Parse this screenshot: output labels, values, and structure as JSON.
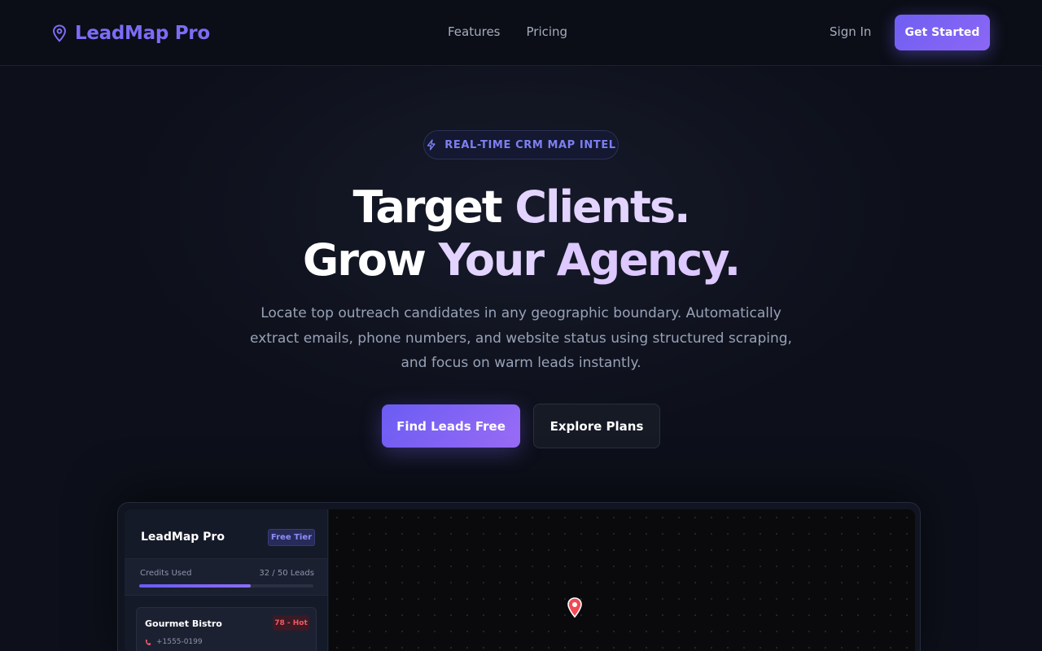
{
  "nav": {
    "brand": "LeadMap Pro",
    "links": [
      {
        "label": "Features"
      },
      {
        "label": "Pricing"
      }
    ],
    "signin": "Sign In",
    "cta": "Get Started"
  },
  "hero": {
    "badge": "REAL-TIME CRM MAP INTEL",
    "headline_line1_a": "Target ",
    "headline_line1_b": "Clients.",
    "headline_line2_a": "Grow ",
    "headline_line2_b": "Your ",
    "headline_line2_c": "Agency.",
    "subtext": "Locate top outreach candidates in any geographic boundary. Automatically extract emails, phone numbers, and website status using structured scraping, and focus on warm leads instantly.",
    "primary_button": "Find Leads Free",
    "secondary_button": "Explore Plans"
  },
  "preview": {
    "title": "LeadMap Pro",
    "tier": "Free Tier",
    "credits_label": "Credits Used",
    "credits_value": "32 / 50 Leads",
    "credits_used": 32,
    "credits_total": 50,
    "leads": [
      {
        "name": "Gourmet Bistro",
        "score": "78 - Hot",
        "phone": "+1555-0199"
      }
    ]
  },
  "colors": {
    "accent": "#7c6cf5",
    "hot": "#ef5a66",
    "background": "#0d101a"
  },
  "icons": {
    "logo": "map-pin-icon",
    "badge": "lightning-bolt-icon",
    "phone": "phone-icon",
    "map_marker": "map-marker-icon"
  }
}
